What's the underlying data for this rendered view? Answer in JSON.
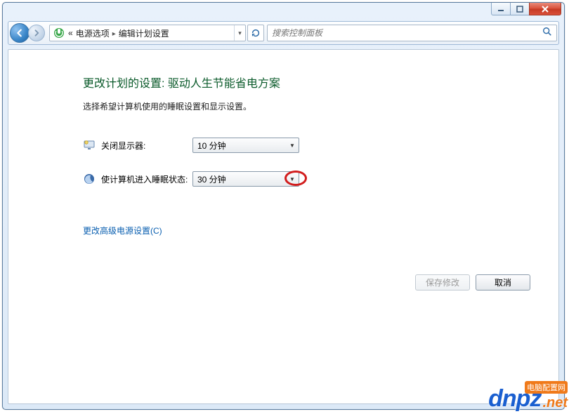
{
  "breadcrumb": {
    "prefix": "«",
    "parent": "电源选项",
    "current": "编辑计划设置"
  },
  "search": {
    "placeholder": "搜索控制面板"
  },
  "page": {
    "title_prefix": "更改计划的设置: ",
    "plan_name": "驱动人生节能省电方案",
    "subtitle": "选择希望计算机使用的睡眠设置和显示设置。"
  },
  "rows": {
    "display_off": {
      "label": "关闭显示器:",
      "value": "10 分钟",
      "icon": "monitor-icon"
    },
    "sleep": {
      "label": "使计算机进入睡眠状态:",
      "value": "30 分钟",
      "icon": "moon-icon"
    }
  },
  "advanced_link": "更改高级电源设置(C)",
  "buttons": {
    "save": "保存修改",
    "cancel": "取消"
  },
  "watermark": {
    "main": "dnpz",
    "net": ".net",
    "tag": "电脑配置网"
  }
}
